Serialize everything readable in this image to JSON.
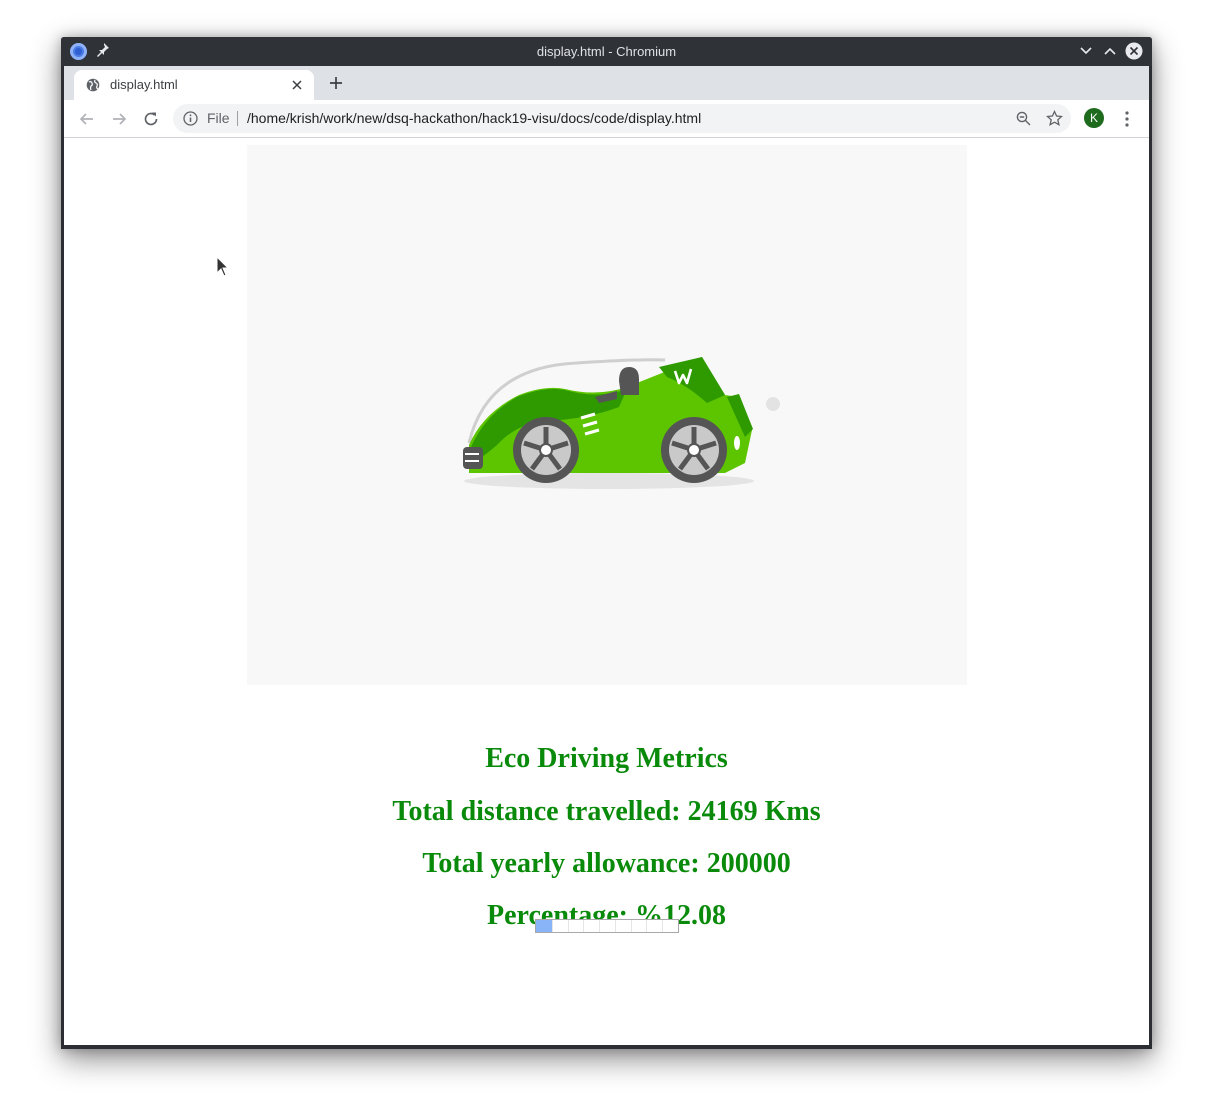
{
  "window": {
    "title": "display.html - Chromium"
  },
  "tabs": [
    {
      "label": "display.html"
    }
  ],
  "omnibox": {
    "scheme": "File",
    "url": "/home/krish/work/new/dsq-hackathon/hack19-visu/docs/code/display.html"
  },
  "profile": {
    "initial": "K",
    "color": "#1e6b1e"
  },
  "page": {
    "hero_image": "green-eco-car-illustration",
    "heading": "Eco Driving Metrics",
    "distance": "Total distance travelled: 24169 Kms",
    "allowance": "Total yearly allowance: 200000",
    "percentage": "Percentage: %12.08",
    "progress": 0.1208,
    "accent_color": "#0a8a0a",
    "progress_color": "#8ab4f8"
  }
}
